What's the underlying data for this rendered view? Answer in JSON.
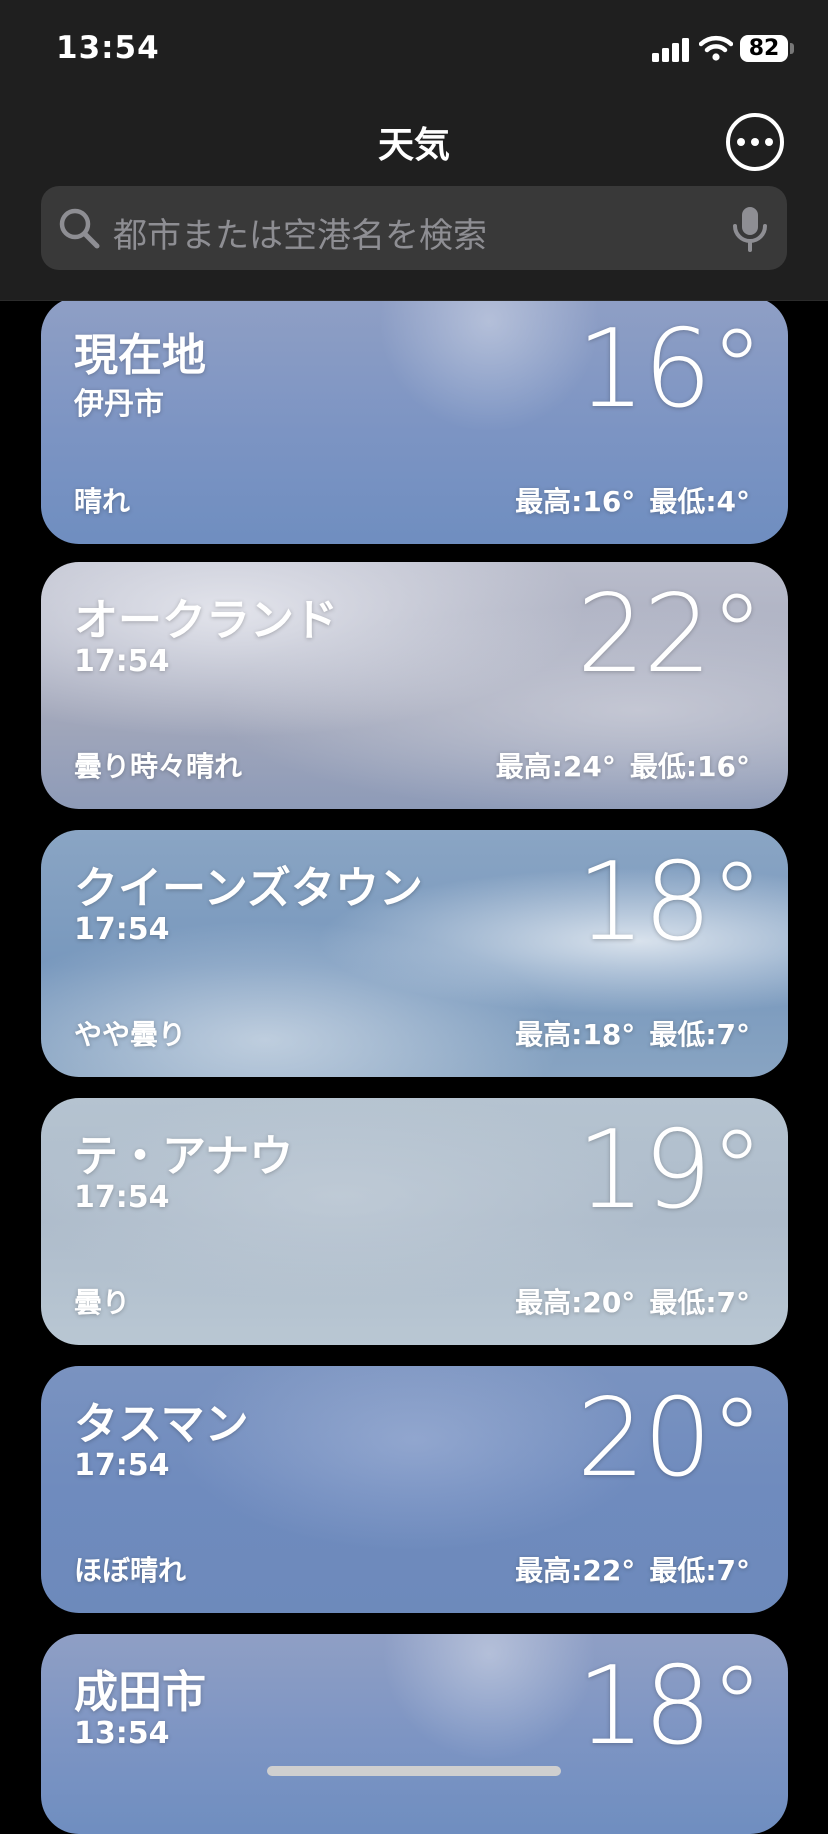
{
  "status_bar": {
    "time": "13:54",
    "battery": "82"
  },
  "header": {
    "title": "天気",
    "search_placeholder": "都市または空港名を検索"
  },
  "locations": [
    {
      "city": "現在地",
      "sub": "伊丹市",
      "temp": "16°",
      "condition": "晴れ",
      "high": "最高:16°",
      "low": "最低:4°"
    },
    {
      "city": "オークランド",
      "sub": "17:54",
      "temp": "22°",
      "condition": "曇り時々晴れ",
      "high": "最高:24°",
      "low": "最低:16°"
    },
    {
      "city": "クイーンズタウン",
      "sub": "17:54",
      "temp": "18°",
      "condition": "やや曇り",
      "high": "最高:18°",
      "low": "最低:7°"
    },
    {
      "city": "テ・アナウ",
      "sub": "17:54",
      "temp": "19°",
      "condition": "曇り",
      "high": "最高:20°",
      "low": "最低:7°"
    },
    {
      "city": "タスマン",
      "sub": "17:54",
      "temp": "20°",
      "condition": "ほぼ晴れ",
      "high": "最高:22°",
      "low": "最低:7°"
    },
    {
      "city": "成田市",
      "sub": "13:54",
      "temp": "18°",
      "condition": "",
      "high": "",
      "low": ""
    }
  ],
  "icons": {
    "signal": "cellular-signal-icon",
    "wifi": "wifi-icon",
    "more": "ellipsis-circle-icon",
    "search": "magnifier-icon",
    "mic": "microphone-icon"
  },
  "colors": {
    "header_bg": "#1f1f1f",
    "search_bg": "#393939",
    "placeholder": "#8e8e93"
  }
}
